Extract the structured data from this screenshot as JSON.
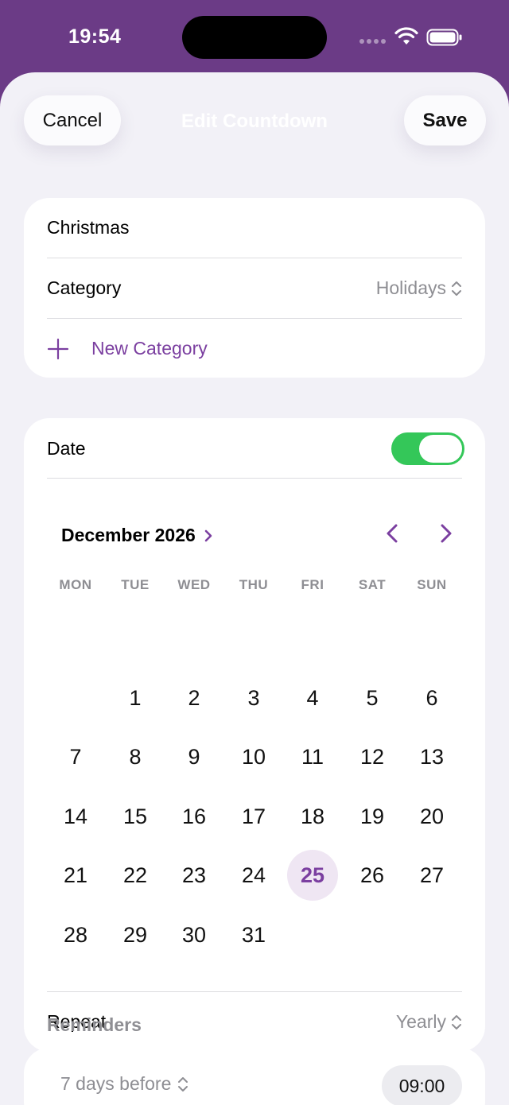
{
  "status_bar": {
    "time": "19:54"
  },
  "nav": {
    "cancel_label": "Cancel",
    "title": "Edit Countdown",
    "save_label": "Save"
  },
  "details": {
    "name": "Christmas",
    "category_label": "Category",
    "category_value": "Holidays",
    "new_category_label": "New Category"
  },
  "date_section": {
    "label": "Date",
    "toggle_on": true,
    "month_label": "December 2026",
    "weekdays": [
      "MON",
      "TUE",
      "WED",
      "THU",
      "FRI",
      "SAT",
      "SUN"
    ],
    "days": [
      "1",
      "2",
      "3",
      "4",
      "5",
      "6",
      "7",
      "8",
      "9",
      "10",
      "11",
      "12",
      "13",
      "14",
      "15",
      "16",
      "17",
      "18",
      "19",
      "20",
      "21",
      "22",
      "23",
      "24",
      "25",
      "26",
      "27",
      "28",
      "29",
      "30",
      "31"
    ],
    "first_weekday_index": 1,
    "selected_day": "25",
    "repeat_label": "Repeat",
    "repeat_value": "Yearly"
  },
  "reminders": {
    "header": "Reminders",
    "offset_value": "7 days before",
    "time_value": "09:00"
  },
  "colors": {
    "accent": "#7b3fa0",
    "toggle_on": "#34c759",
    "header_bg": "#6b3b86",
    "sheet_bg": "#f2f1f7"
  }
}
